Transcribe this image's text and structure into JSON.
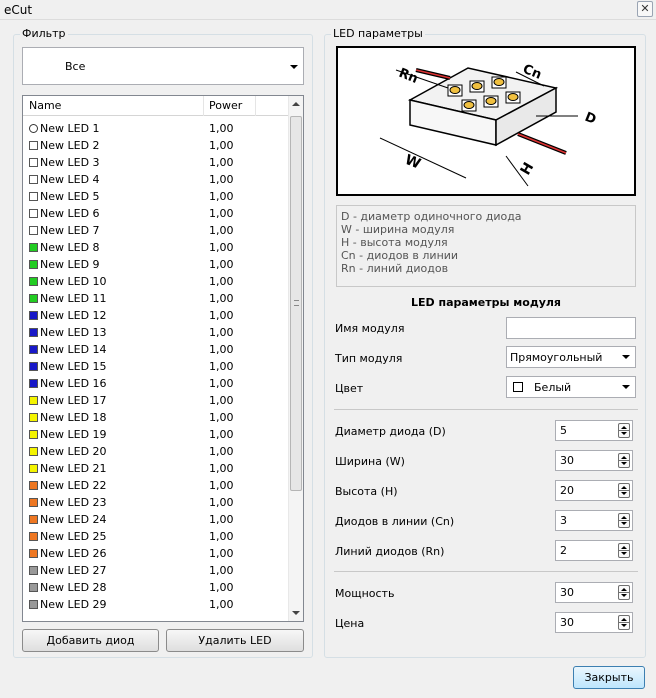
{
  "window": {
    "title": "eCut",
    "close_glyph": "✕"
  },
  "filter": {
    "group_title": "Фильтр",
    "selected": "Все"
  },
  "led_list": {
    "columns": [
      "Name",
      "Power"
    ],
    "rows": [
      {
        "name": "New LED 1",
        "power": "1,00",
        "color": "#ffffff",
        "shape": "circle"
      },
      {
        "name": "New LED 2",
        "power": "1,00",
        "color": "#ffffff"
      },
      {
        "name": "New LED 3",
        "power": "1,00",
        "color": "#ffffff"
      },
      {
        "name": "New LED 4",
        "power": "1,00",
        "color": "#ffffff"
      },
      {
        "name": "New LED 5",
        "power": "1,00",
        "color": "#ffffff"
      },
      {
        "name": "New LED 6",
        "power": "1,00",
        "color": "#ffffff"
      },
      {
        "name": "New LED 7",
        "power": "1,00",
        "color": "#ffffff"
      },
      {
        "name": "New LED 8",
        "power": "1,00",
        "color": "#22cc22"
      },
      {
        "name": "New LED 9",
        "power": "1,00",
        "color": "#22cc22"
      },
      {
        "name": "New LED 10",
        "power": "1,00",
        "color": "#22cc22"
      },
      {
        "name": "New LED 11",
        "power": "1,00",
        "color": "#22cc22"
      },
      {
        "name": "New LED 12",
        "power": "1,00",
        "color": "#1818c8"
      },
      {
        "name": "New LED 13",
        "power": "1,00",
        "color": "#1818c8"
      },
      {
        "name": "New LED 14",
        "power": "1,00",
        "color": "#1818c8"
      },
      {
        "name": "New LED 15",
        "power": "1,00",
        "color": "#1818c8"
      },
      {
        "name": "New LED 16",
        "power": "1,00",
        "color": "#1818c8"
      },
      {
        "name": "New LED 17",
        "power": "1,00",
        "color": "#f4f400"
      },
      {
        "name": "New LED 18",
        "power": "1,00",
        "color": "#f4f400"
      },
      {
        "name": "New LED 19",
        "power": "1,00",
        "color": "#f4f400"
      },
      {
        "name": "New LED 20",
        "power": "1,00",
        "color": "#f4f400"
      },
      {
        "name": "New LED 21",
        "power": "1,00",
        "color": "#f4f400"
      },
      {
        "name": "New LED 22",
        "power": "1,00",
        "color": "#ee7722"
      },
      {
        "name": "New LED 23",
        "power": "1,00",
        "color": "#ee7722"
      },
      {
        "name": "New LED 24",
        "power": "1,00",
        "color": "#ee7722"
      },
      {
        "name": "New LED 25",
        "power": "1,00",
        "color": "#ee7722"
      },
      {
        "name": "New LED 26",
        "power": "1,00",
        "color": "#ee7722"
      },
      {
        "name": "New LED 27",
        "power": "1,00",
        "color": "#999999"
      },
      {
        "name": "New LED 28",
        "power": "1,00",
        "color": "#999999"
      },
      {
        "name": "New LED 29",
        "power": "1,00",
        "color": "#999999"
      }
    ]
  },
  "buttons": {
    "add": "Добавить диод",
    "delete": "Удалить LED",
    "close": "Закрыть"
  },
  "params": {
    "group_title": "LED параметры",
    "diagram_labels": {
      "rn": "Rn",
      "cn": "Cn",
      "d": "D",
      "w": "W",
      "h": "H"
    },
    "legend": [
      "D - диаметр одиночного диода",
      "W - ширина модуля",
      "H - высота модуля",
      "Cn - диодов в линии",
      "Rn - линий диодов"
    ],
    "section_title": "LED параметры модуля",
    "module_name": {
      "label": "Имя модуля",
      "value": ""
    },
    "module_type": {
      "label": "Тип модуля",
      "value": "Прямоугольный"
    },
    "color": {
      "label": "Цвет",
      "value": "Белый"
    },
    "diameter": {
      "label": "Диаметр диода (D)",
      "value": "5"
    },
    "width": {
      "label": "Ширина (W)",
      "value": "30"
    },
    "height": {
      "label": "Высота (H)",
      "value": "20"
    },
    "per_line": {
      "label": "Диодов в линии (Cn)",
      "value": "3"
    },
    "lines": {
      "label": "Линий диодов (Rn)",
      "value": "2"
    },
    "power": {
      "label": "Мощность",
      "value": "30"
    },
    "price": {
      "label": "Цена",
      "value": "30"
    }
  }
}
